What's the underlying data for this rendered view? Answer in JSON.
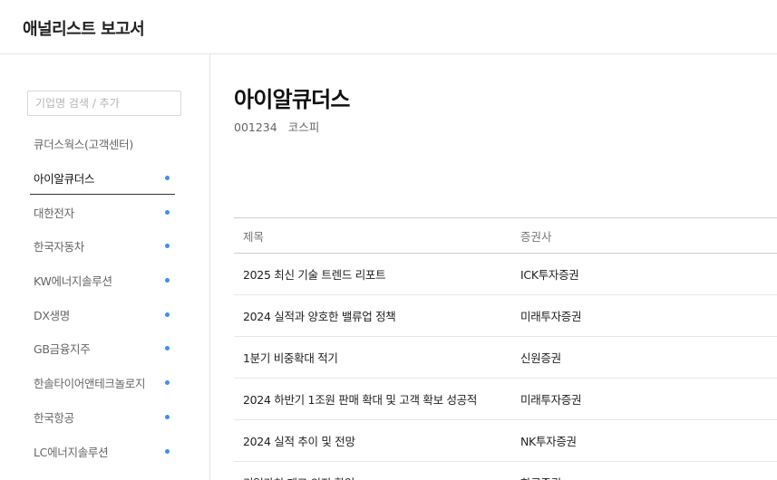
{
  "header": {
    "title": "애널리스트 보고서"
  },
  "sidebar": {
    "search_placeholder": "기업명 검색 / 추가",
    "items": [
      {
        "label": "큐더스웍스(고객센터)",
        "dot": false,
        "active": false
      },
      {
        "label": "아이알큐더스",
        "dot": true,
        "active": true
      },
      {
        "label": "대한전자",
        "dot": true,
        "active": false
      },
      {
        "label": "한국자동차",
        "dot": true,
        "active": false
      },
      {
        "label": "KW에너지솔루션",
        "dot": true,
        "active": false
      },
      {
        "label": "DX생명",
        "dot": true,
        "active": false
      },
      {
        "label": "GB금융지주",
        "dot": true,
        "active": false
      },
      {
        "label": "한솔타이어앤테크놀로지",
        "dot": true,
        "active": false
      },
      {
        "label": "한국항공",
        "dot": true,
        "active": false
      },
      {
        "label": "LC에너지솔루션",
        "dot": true,
        "active": false
      }
    ]
  },
  "company": {
    "name": "아이알큐더스",
    "code": "001234",
    "market": "코스피"
  },
  "table": {
    "headers": {
      "title": "제목",
      "broker": "증권사"
    },
    "rows": [
      {
        "title": "2025 최신 기술 트렌드 리포트",
        "broker": "ICK투자증권"
      },
      {
        "title": "2024 실적과 양호한 밸류업 정책",
        "broker": "미래투자증권"
      },
      {
        "title": "1분기 비중확대 적기",
        "broker": "신원증권"
      },
      {
        "title": "2024 하반기 1조원 판매 확대 및 고객 확보 성공적",
        "broker": "미래투자증권"
      },
      {
        "title": "2024 실적 추이 및 전망",
        "broker": "NK투자증권"
      },
      {
        "title": "기업가치 제고 의지 확인",
        "broker": "한국증권"
      }
    ]
  },
  "colors": {
    "accent_dot": "#3d8ef0",
    "border": "#e5e5e5"
  }
}
